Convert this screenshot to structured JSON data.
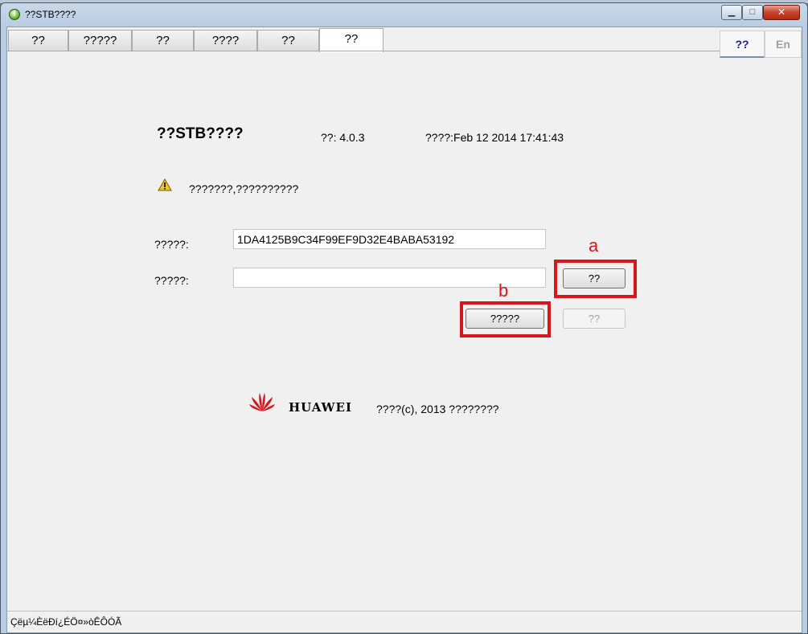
{
  "window": {
    "title": "??STB????",
    "min_label": "▁",
    "max_label": "□",
    "close_label": "✕"
  },
  "tabs": [
    {
      "label": "??"
    },
    {
      "label": "?????"
    },
    {
      "label": "??"
    },
    {
      "label": "????"
    },
    {
      "label": "??"
    },
    {
      "label": "??",
      "active": true
    }
  ],
  "language": {
    "zh_label": "??",
    "en_label": "En",
    "selected": "zh"
  },
  "about": {
    "product_title": "??STB????",
    "version": "??: 4.0.3",
    "build_date": "????:Feb 12 2014  17:41:43",
    "warning": "???????,??????????",
    "warning_icon": "warning-triangle-icon"
  },
  "form": {
    "label_1": "?????:",
    "value_1": "1DA4125B9C34F99EF9D32E4BABA53192",
    "label_2": "?????:",
    "value_2": "",
    "generate_button": "??",
    "copy_button": "?????",
    "disabled_button": "??"
  },
  "annotations": {
    "a": "a",
    "b": "b",
    "color": "#d7161d"
  },
  "footer": {
    "brand": "HUAWEI",
    "copyright": "????(c), 2013 ????????",
    "logo_color": "#d7161d"
  },
  "status": {
    "text": "Çëµ¼ÈëÐí¿ÉÖ¤»òÊÔÓÃ"
  }
}
